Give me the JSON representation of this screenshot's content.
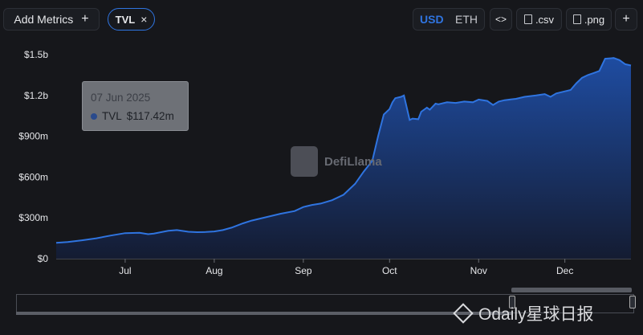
{
  "toolbar": {
    "add_metrics_label": "Add Metrics",
    "add_metrics_icon": "+",
    "active_metric": "TVL",
    "remove_icon": "×",
    "currency_usd": "USD",
    "currency_eth": "ETH",
    "selected_currency": "USD",
    "embed_icon": "<>",
    "csv_label": ".csv",
    "png_label": ".png",
    "more_icon": "+"
  },
  "tooltip": {
    "date": "07 Jun 2025",
    "series": "TVL",
    "value": "$117.42m"
  },
  "watermark": {
    "text": "DefiLlama"
  },
  "corner_watermark": {
    "text": "Odaily星球日报"
  },
  "colors": {
    "background": "#16171b",
    "line": "#2f74e0",
    "accent": "#2f74e0",
    "area_top": "#1f4fa8",
    "area_bottom": "#141c33"
  },
  "chart_data": {
    "type": "area",
    "title": "",
    "xlabel": "",
    "ylabel": "",
    "ylim": [
      0,
      1500
    ],
    "y_ticks": [
      0,
      300,
      600,
      900,
      1200,
      1500
    ],
    "y_tick_labels": [
      "$0",
      "$300m",
      "$600m",
      "$900m",
      "$1.2b",
      "$1.5b"
    ],
    "x_tick_labels": [
      "Jul",
      "Aug",
      "Sep",
      "Oct",
      "Nov",
      "Dec"
    ],
    "x_tick_dates": [
      "2025-07-01",
      "2025-08-01",
      "2025-09-01",
      "2025-10-01",
      "2025-11-01",
      "2025-12-01"
    ],
    "x_range": [
      "2025-06-07",
      "2025-12-24"
    ],
    "series": [
      {
        "name": "TVL",
        "x": [
          "2025-06-07",
          "2025-06-11",
          "2025-06-16",
          "2025-06-21",
          "2025-06-26",
          "2025-07-01",
          "2025-07-06",
          "2025-07-09",
          "2025-07-11",
          "2025-07-16",
          "2025-07-19",
          "2025-07-23",
          "2025-07-26",
          "2025-07-29",
          "2025-08-01",
          "2025-08-04",
          "2025-08-07",
          "2025-08-11",
          "2025-08-14",
          "2025-08-19",
          "2025-08-24",
          "2025-08-29",
          "2025-09-01",
          "2025-09-04",
          "2025-09-07",
          "2025-09-11",
          "2025-09-15",
          "2025-09-19",
          "2025-09-22",
          "2025-09-25",
          "2025-09-27",
          "2025-09-29",
          "2025-10-01",
          "2025-10-02",
          "2025-10-03",
          "2025-10-05",
          "2025-10-06",
          "2025-10-08",
          "2025-10-09",
          "2025-10-11",
          "2025-10-12",
          "2025-10-14",
          "2025-10-15",
          "2025-10-17",
          "2025-10-18",
          "2025-10-21",
          "2025-10-24",
          "2025-10-27",
          "2025-10-30",
          "2025-11-01",
          "2025-11-04",
          "2025-11-06",
          "2025-11-08",
          "2025-11-10",
          "2025-11-14",
          "2025-11-17",
          "2025-11-21",
          "2025-11-24",
          "2025-11-26",
          "2025-11-28",
          "2025-12-01",
          "2025-12-03",
          "2025-12-05",
          "2025-12-07",
          "2025-12-09",
          "2025-12-11",
          "2025-12-13",
          "2025-12-15",
          "2025-12-18",
          "2025-12-20",
          "2025-12-22",
          "2025-12-24"
        ],
        "values": [
          117,
          122,
          135,
          150,
          170,
          188,
          190,
          180,
          185,
          205,
          210,
          198,
          195,
          196,
          200,
          210,
          228,
          260,
          280,
          305,
          330,
          350,
          380,
          395,
          405,
          430,
          470,
          550,
          640,
          720,
          900,
          1060,
          1100,
          1150,
          1180,
          1190,
          1200,
          1020,
          1030,
          1025,
          1080,
          1110,
          1095,
          1140,
          1135,
          1150,
          1145,
          1155,
          1150,
          1170,
          1160,
          1130,
          1155,
          1165,
          1175,
          1190,
          1200,
          1210,
          1190,
          1215,
          1230,
          1240,
          1290,
          1330,
          1350,
          1365,
          1380,
          1470,
          1475,
          1460,
          1430,
          1420
        ]
      }
    ],
    "grid": false,
    "legend": "none"
  }
}
